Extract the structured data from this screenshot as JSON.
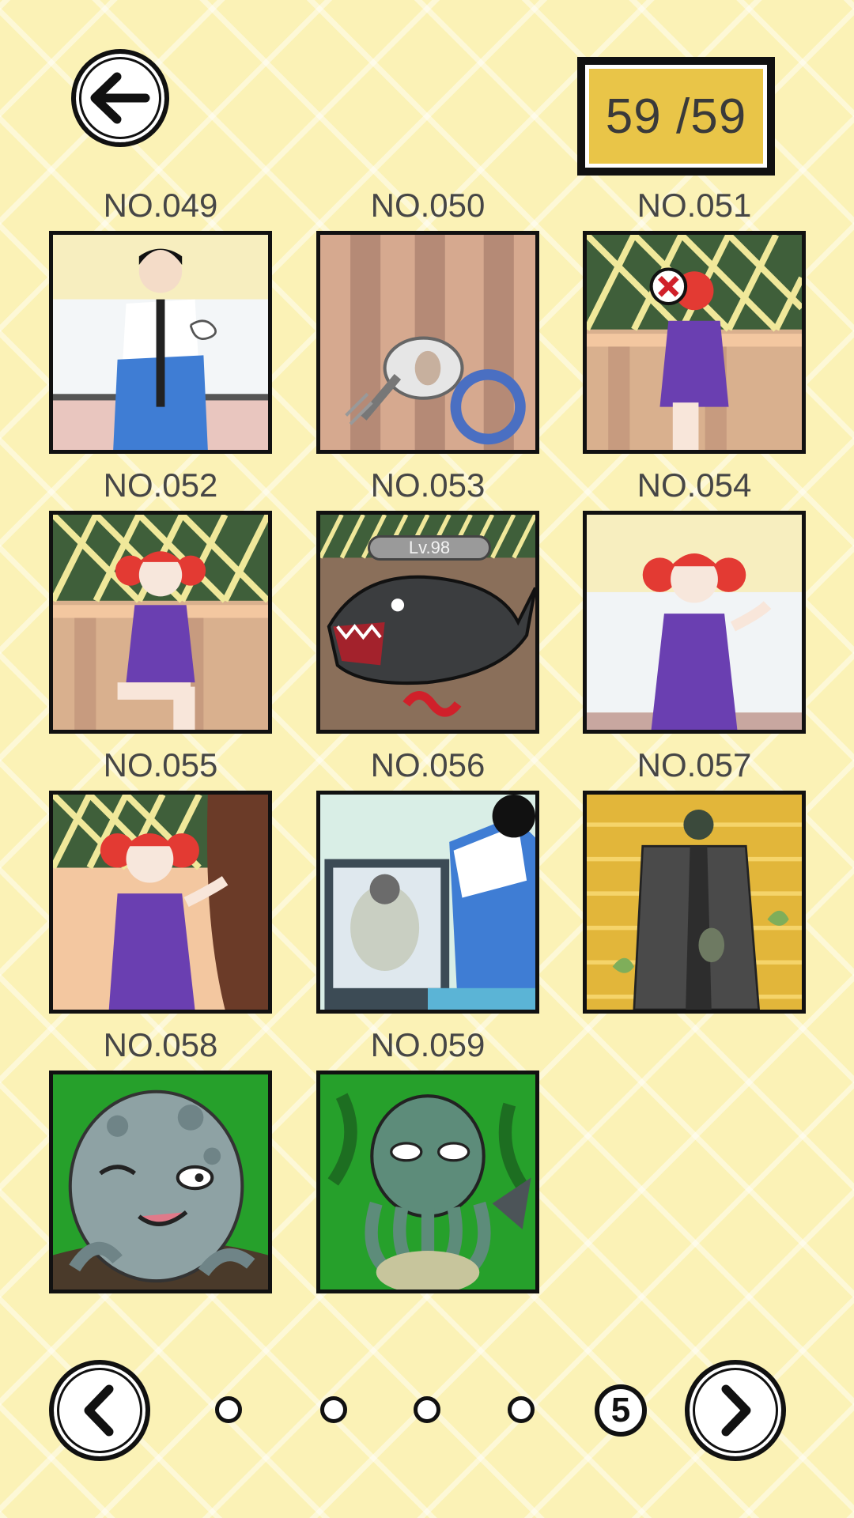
{
  "header": {
    "back_icon": "arrow-left-icon",
    "counter_text": "59 /59"
  },
  "gallery": {
    "items": [
      {
        "label": "NO.049",
        "scene": "boy in tracksuit panting"
      },
      {
        "label": "NO.050",
        "scene": "hand mixer and ring"
      },
      {
        "label": "NO.051",
        "scene": "girl covering face"
      },
      {
        "label": "NO.052",
        "scene": "girl sitting on bench"
      },
      {
        "label": "NO.053",
        "scene": "shark monster"
      },
      {
        "label": "NO.054",
        "scene": "girl shrugging"
      },
      {
        "label": "NO.055",
        "scene": "girl by tree"
      },
      {
        "label": "NO.056",
        "scene": "boy looking at screen"
      },
      {
        "label": "NO.057",
        "scene": "robed figure"
      },
      {
        "label": "NO.058",
        "scene": "octopus creature"
      },
      {
        "label": "NO.059",
        "scene": "cthulhu creature"
      }
    ],
    "badge_text": "Lv.98"
  },
  "pager": {
    "prev_icon": "chevron-left-icon",
    "next_icon": "chevron-right-icon",
    "current_page": "5",
    "total_pages": 5
  },
  "colors": {
    "background": "#fbf2b6",
    "counter_fill": "#e9c548",
    "outline": "#111111"
  }
}
